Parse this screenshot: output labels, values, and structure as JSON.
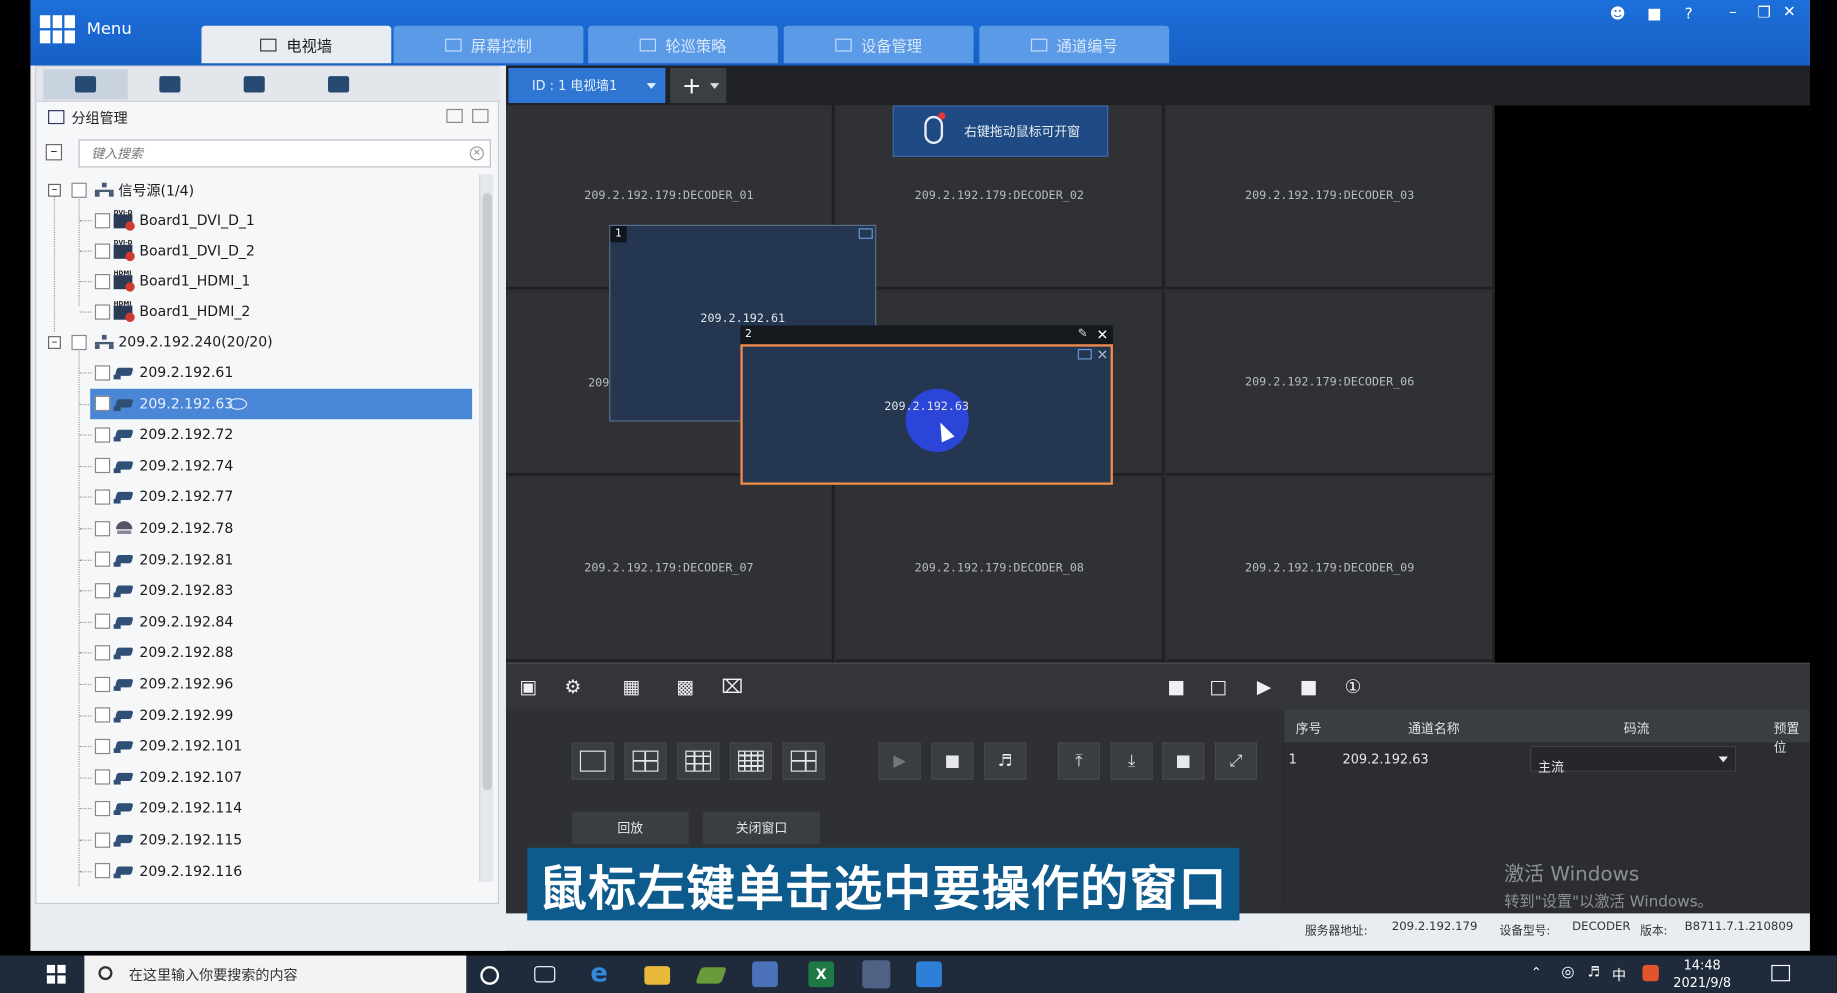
{
  "app": {
    "menu_label": "Menu",
    "tabs": [
      {
        "label": "电视墙",
        "active": true
      },
      {
        "label": "屏幕控制",
        "active": false
      },
      {
        "label": "轮巡策略",
        "active": false
      },
      {
        "label": "设备管理",
        "active": false
      },
      {
        "label": "通道编号",
        "active": false
      }
    ],
    "window_controls": [
      "user-icon",
      "lock-icon",
      "help-icon",
      "minimize-icon",
      "restore-icon",
      "close-icon"
    ]
  },
  "left_panel": {
    "group_title": "分组管理",
    "search_placeholder": "键入搜索",
    "tree": {
      "signal_group": "信号源(1/4)",
      "signals": [
        "Board1_DVI_D_1",
        "Board1_DVI_D_2",
        "Board1_HDMI_1",
        "Board1_HDMI_2"
      ],
      "device_group": "209.2.192.240(20/20)",
      "cameras": [
        {
          "label": "209.2.192.61",
          "type": "camera"
        },
        {
          "label": "209.2.192.63",
          "type": "camera",
          "selected": true
        },
        {
          "label": "209.2.192.72",
          "type": "camera"
        },
        {
          "label": "209.2.192.74",
          "type": "camera"
        },
        {
          "label": "209.2.192.77",
          "type": "camera"
        },
        {
          "label": "209.2.192.78",
          "type": "dome"
        },
        {
          "label": "209.2.192.81",
          "type": "camera"
        },
        {
          "label": "209.2.192.83",
          "type": "camera"
        },
        {
          "label": "209.2.192.84",
          "type": "camera"
        },
        {
          "label": "209.2.192.88",
          "type": "camera"
        },
        {
          "label": "209.2.192.96",
          "type": "camera"
        },
        {
          "label": "209.2.192.99",
          "type": "camera"
        },
        {
          "label": "209.2.192.101",
          "type": "camera"
        },
        {
          "label": "209.2.192.107",
          "type": "camera"
        },
        {
          "label": "209.2.192.114",
          "type": "camera"
        },
        {
          "label": "209.2.192.115",
          "type": "camera"
        },
        {
          "label": "209.2.192.116",
          "type": "camera"
        }
      ]
    }
  },
  "wall": {
    "tab_label": "ID : 1 电视墙1",
    "hint": "右键拖动鼠标可开窗",
    "cells": [
      "209.2.192.179:DECODER_01",
      "209.2.192.179:DECODER_02",
      "209.2.192.179:DECODER_03",
      "",
      "",
      "209.2.192.179:DECODER_06",
      "209.2.192.179:DECODER_07",
      "209.2.192.179:DECODER_08",
      "209.2.192.179:DECODER_09"
    ],
    "window1": {
      "num": "1",
      "name": "209.2.192.61",
      "partial_label": "209"
    },
    "window2": {
      "num": "2",
      "name": "209.2.192.63"
    }
  },
  "bottom": {
    "playback_label": "回放",
    "close_window_label": "关闭窗口",
    "table": {
      "headers": [
        "序号",
        "通道名称",
        "码流",
        "预置位"
      ],
      "rows": [
        {
          "index": "1",
          "channel": "209.2.192.63",
          "stream": "主流"
        }
      ]
    }
  },
  "status": {
    "server_label": "服务器地址:",
    "server_value": "209.2.192.179",
    "model_label": "设备型号:",
    "model_value": "DECODER",
    "version_label": "版本:",
    "version_value": "B8711.7.1.210809"
  },
  "overlay": {
    "subtitle": "鼠标左键单击选中要操作的窗口",
    "activate_line1": "激活 Windows",
    "activate_line2": "转到\"设置\"以激活 Windows。"
  },
  "taskbar": {
    "search_placeholder": "在这里输入你要搜索的内容",
    "time": "14:48",
    "date": "2021/9/8",
    "ime": "中"
  }
}
